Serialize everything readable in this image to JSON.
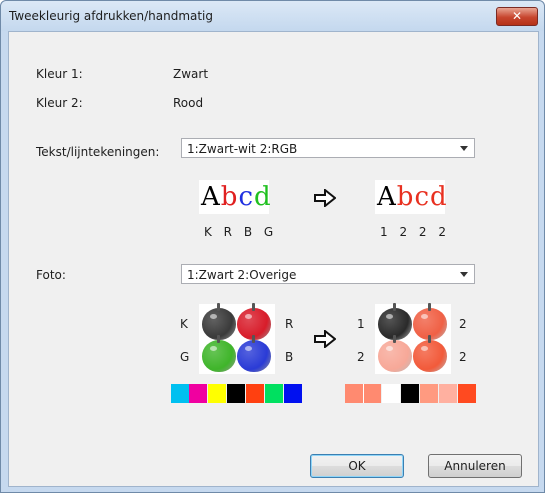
{
  "window": {
    "title": "Tweekleurig afdrukken/handmatig",
    "close_label": "✕"
  },
  "colors": {
    "kleur1": {
      "label": "Kleur 1:",
      "value": "Zwart"
    },
    "kleur2": {
      "label": "Kleur 2:",
      "value": "Rood"
    }
  },
  "text_section": {
    "label": "Tekst/lijntekeningen:",
    "selected": "1:Zwart-wit 2:RGB",
    "sample_word": "Abcd",
    "before_letters": "K R B G",
    "after_letters": "1 2 2 2",
    "before_colors": [
      "#000000",
      "#e02020",
      "#2030e0",
      "#20c020"
    ],
    "after_colors": [
      "#000000",
      "#e83020",
      "#e83020",
      "#e83020"
    ]
  },
  "photo_section": {
    "label": "Foto:",
    "selected": "1:Zwart 2:Overige",
    "before_labels": {
      "tl": "K",
      "tr": "R",
      "bl": "G",
      "br": "B"
    },
    "after_labels": {
      "tl": "1",
      "tr": "2",
      "bl": "2",
      "br": "2"
    },
    "before_apples": [
      "#3a3a3a",
      "#d81c2a",
      "#3fb52a",
      "#2a3bd6"
    ],
    "after_apples": [
      "#2a2a2a",
      "#f06045",
      "#f7a898",
      "#f25a3a"
    ],
    "before_swatches": [
      "#00c0f0",
      "#f000a0",
      "#ffff00",
      "#000000",
      "#ff4010",
      "#00e060",
      "#0010f0"
    ],
    "after_swatches": [
      "#ff8a70",
      "#ff8a70",
      "#ffffff",
      "#000000",
      "#ff9a80",
      "#ffb0a0",
      "#ff4a20"
    ]
  },
  "buttons": {
    "ok": "OK",
    "cancel": "Annuleren"
  }
}
